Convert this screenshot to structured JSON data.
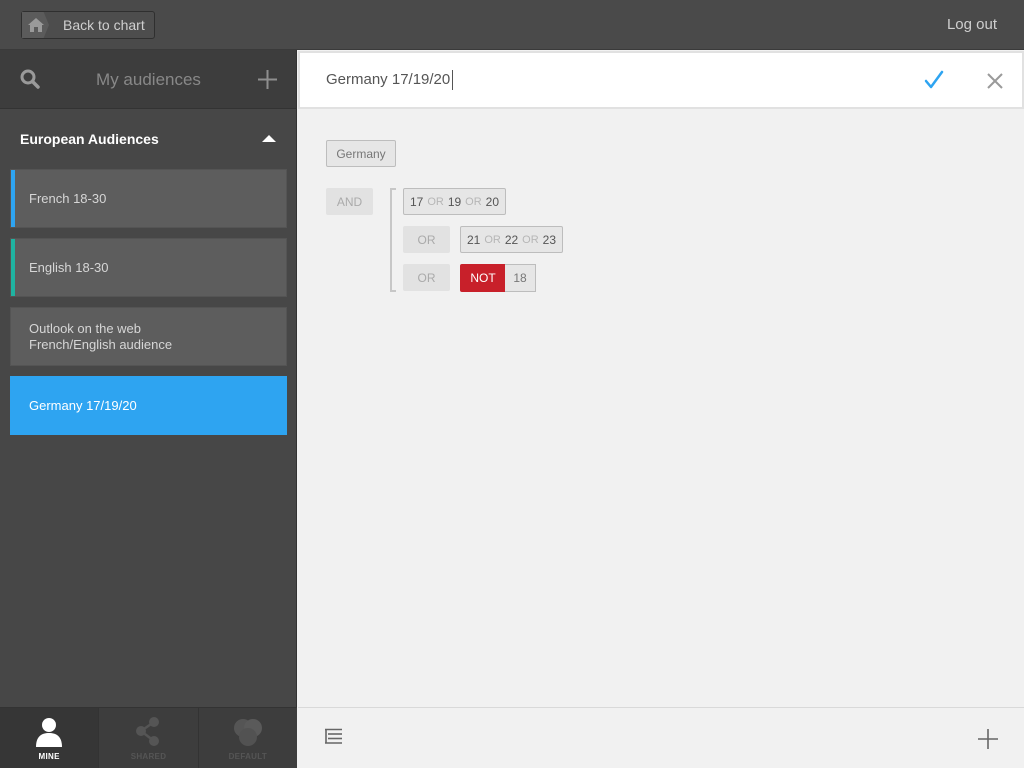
{
  "topbar": {
    "back_label": "Back to chart",
    "logout_label": "Log out"
  },
  "sidebar": {
    "title": "My audiences",
    "group_title": "European Audiences",
    "items": [
      {
        "line1": "French 18-30",
        "line2": "",
        "accent": "#2ea4f1"
      },
      {
        "line1": "English 18-30",
        "line2": "",
        "accent": "#1fb3a1"
      },
      {
        "line1": "Outlook on the web",
        "line2": "French/English audience",
        "accent": ""
      },
      {
        "line1": "Germany 17/19/20",
        "line2": "",
        "accent": ""
      }
    ],
    "tabs": [
      {
        "label": "MINE",
        "active": true
      },
      {
        "label": "SHARED",
        "active": false
      },
      {
        "label": "DEFAULT",
        "active": false
      }
    ]
  },
  "editor": {
    "name_value": "Germany 17/19/20",
    "country_chip": "Germany",
    "and_label": "AND",
    "or_label": "OR",
    "not_label": "NOT",
    "row1": {
      "a": "17",
      "b": "19",
      "c": "20"
    },
    "row2": {
      "a": "21",
      "b": "22",
      "c": "23"
    },
    "row3_value": "18"
  },
  "colors": {
    "accent": "#2ea4f1",
    "not_red": "#c8202a"
  }
}
